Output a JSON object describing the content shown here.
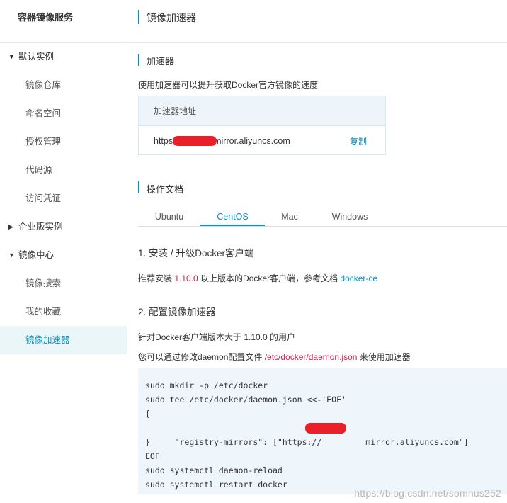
{
  "sidebar": {
    "title": "容器镜像服务",
    "groups": [
      {
        "label": "默认实例",
        "expanded": true,
        "items": [
          "镜像仓库",
          "命名空间",
          "授权管理",
          "代码源",
          "访问凭证"
        ]
      },
      {
        "label": "企业版实例",
        "expanded": false,
        "items": []
      },
      {
        "label": "镜像中心",
        "expanded": true,
        "items": [
          "镜像搜索",
          "我的收藏",
          "镜像加速器"
        ]
      }
    ],
    "active_item": "镜像加速器"
  },
  "header": {
    "title": "镜像加速器"
  },
  "accelerator": {
    "section_title": "加速器",
    "description": "使用加速器可以提升获取Docker官方镜像的速度",
    "table_header": "加速器地址",
    "url_prefix": "https",
    "url_suffix": "mirror.aliyuncs.com",
    "copy_label": "复制"
  },
  "docs": {
    "section_title": "操作文档",
    "tabs": [
      "Ubuntu",
      "CentOS",
      "Mac",
      "Windows"
    ],
    "active_tab": "CentOS",
    "step1": {
      "title": "1. 安装 / 升级Docker客户端",
      "text_before": "推荐安装 ",
      "version": "1.10.0",
      "text_after": " 以上版本的Docker客户端，参考文档 ",
      "link": "docker-ce"
    },
    "step2": {
      "title": "2. 配置镜像加速器",
      "line1": "针对Docker客户端版本大于 1.10.0 的用户",
      "line2_before": "您可以通过修改daemon配置文件 ",
      "line2_path": "/etc/docker/daemon.json",
      "line2_after": " 来使用加速器"
    },
    "code_lines": [
      "sudo mkdir -p /etc/docker",
      "sudo tee /etc/docker/daemon.json <<-'EOF'",
      "{",
      "  \"registry-mirrors\": [\"https://",
      "}",
      "EOF",
      "sudo systemctl daemon-reload",
      "sudo systemctl restart docker"
    ],
    "code_line4_suffix": "mirror.aliyuncs.com\"]"
  },
  "watermark": "https://blog.csdn.net/somnus252",
  "colors": {
    "accent": "#0b8fc0",
    "code_highlight": "#c7254e",
    "redaction": "#e8202a"
  }
}
